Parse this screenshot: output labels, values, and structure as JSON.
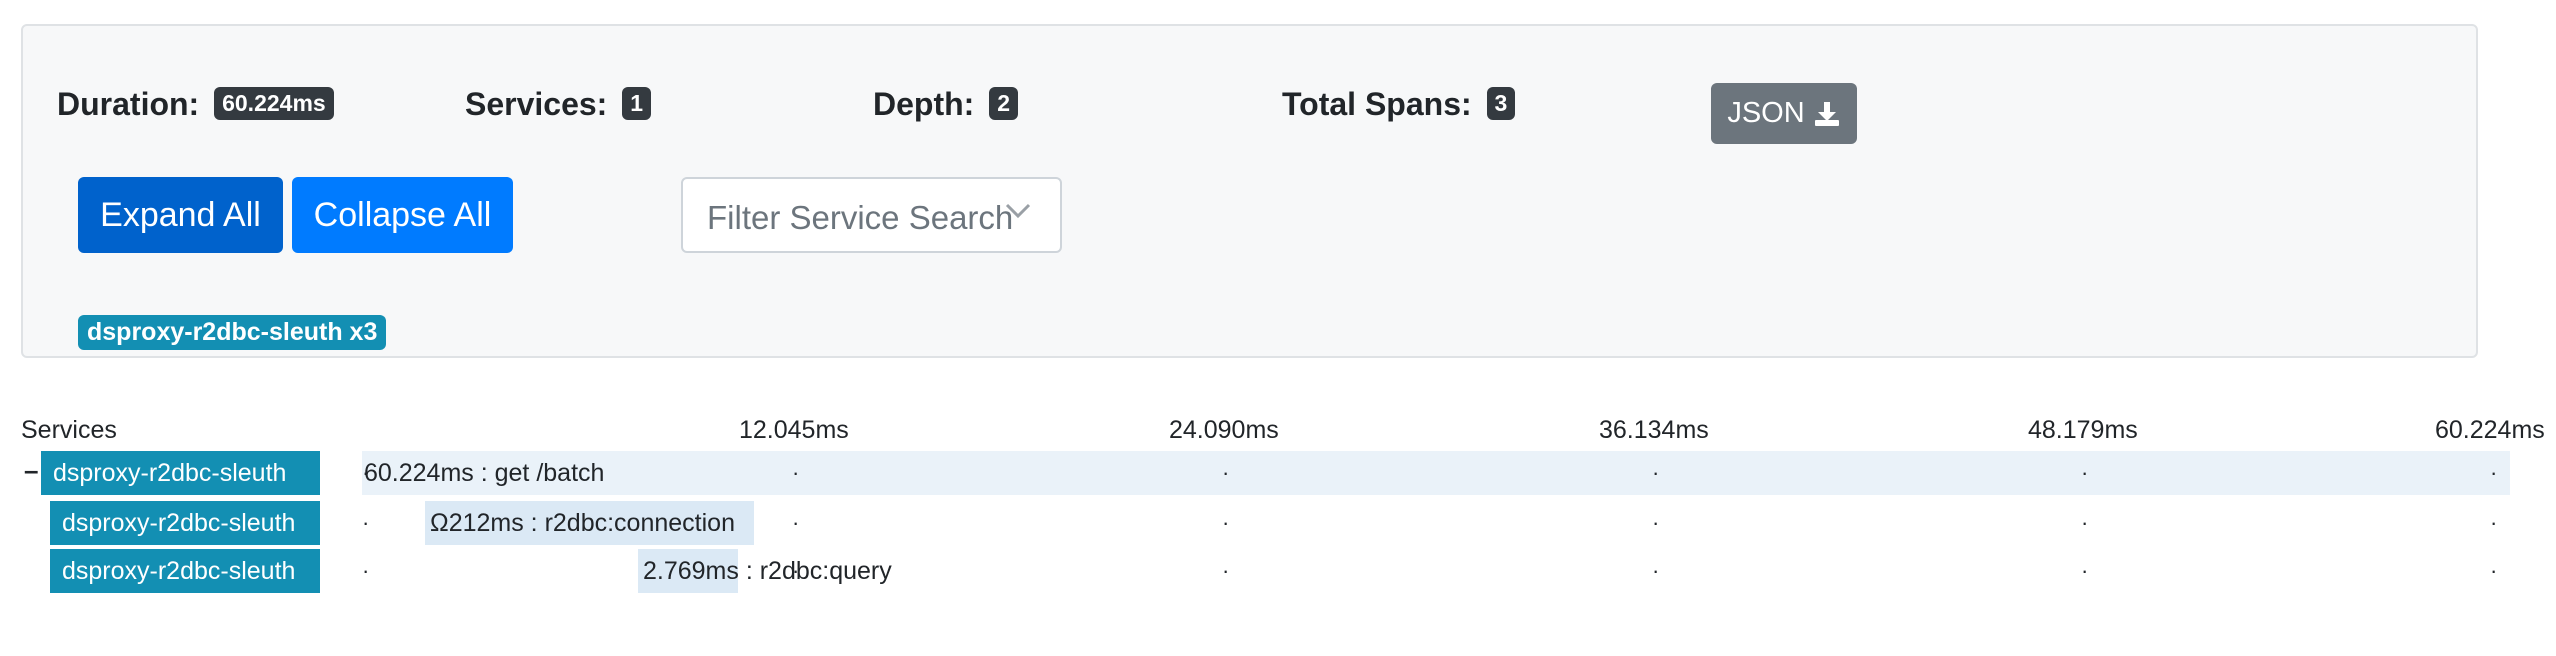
{
  "summary": {
    "duration_label": "Duration:",
    "duration_value": "60.224ms",
    "services_label": "Services:",
    "services_value": "1",
    "depth_label": "Depth:",
    "depth_value": "2",
    "total_spans_label": "Total Spans:",
    "total_spans_value": "3"
  },
  "toolbar": {
    "json_label": "JSON",
    "expand_label": "Expand All",
    "collapse_label": "Collapse All",
    "filter_placeholder": "Filter Service Search"
  },
  "service_tags": [
    "dsproxy-r2dbc-sleuth x3"
  ],
  "timeline": {
    "header_label": "Services",
    "ticks": [
      "12.045ms",
      "24.090ms",
      "36.134ms",
      "48.179ms",
      "60.224ms"
    ],
    "toggle": "–",
    "spans": [
      {
        "service": "dsproxy-r2dbc-sleuth",
        "label": "60.224ms : get /batch"
      },
      {
        "service": "dsproxy-r2dbc-sleuth",
        "label": "Ω212ms : r2dbc:connection"
      },
      {
        "service": "dsproxy-r2dbc-sleuth",
        "label": "2.769ms : r2dbc:query"
      }
    ]
  },
  "colors": {
    "service_badge": "#138fb3",
    "expand_button": "#0062cc",
    "collapse_button": "#007bff",
    "json_button": "#6c757d",
    "span_bar": "#dbe9f5"
  }
}
